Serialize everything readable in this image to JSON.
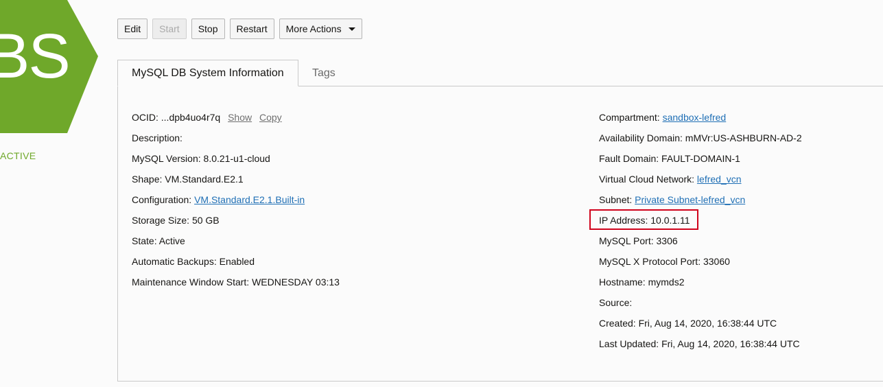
{
  "badge": {
    "text": "BS",
    "color": "#6fa82a",
    "status": "ACTIVE"
  },
  "toolbar": {
    "edit": "Edit",
    "start": "Start",
    "stop": "Stop",
    "restart": "Restart",
    "more_actions": "More Actions"
  },
  "tabs": {
    "info": "MySQL DB System Information",
    "tags": "Tags"
  },
  "left": {
    "ocid_label": "OCID:",
    "ocid_value": "...dpb4uo4r7q",
    "ocid_show": "Show",
    "ocid_copy": "Copy",
    "description_label": "Description:",
    "mysql_version_label": "MySQL Version:",
    "mysql_version_value": "8.0.21-u1-cloud",
    "shape_label": "Shape:",
    "shape_value": "VM.Standard.E2.1",
    "configuration_label": "Configuration:",
    "configuration_value": "VM.Standard.E2.1.Built-in",
    "storage_label": "Storage Size:",
    "storage_value": "50 GB",
    "state_label": "State:",
    "state_value": "Active",
    "backups_label": "Automatic Backups:",
    "backups_value": "Enabled",
    "maintenance_label": "Maintenance Window Start:",
    "maintenance_value": "WEDNESDAY 03:13"
  },
  "right": {
    "compartment_label": "Compartment:",
    "compartment_value": "sandbox-lefred",
    "ad_label": "Availability Domain:",
    "ad_value": "mMVr:US-ASHBURN-AD-2",
    "fault_label": "Fault Domain:",
    "fault_value": "FAULT-DOMAIN-1",
    "vcn_label": "Virtual Cloud Network:",
    "vcn_value": "lefred_vcn",
    "subnet_label": "Subnet:",
    "subnet_value": "Private Subnet-lefred_vcn",
    "ip_label": "IP Address:",
    "ip_value": "10.0.1.11",
    "port_label": "MySQL Port:",
    "port_value": "3306",
    "xport_label": "MySQL X Protocol Port:",
    "xport_value": "33060",
    "hostname_label": "Hostname:",
    "hostname_value": "mymds2",
    "source_label": "Source:",
    "created_label": "Created:",
    "created_value": "Fri, Aug 14, 2020, 16:38:44 UTC",
    "updated_label": "Last Updated:",
    "updated_value": "Fri, Aug 14, 2020, 16:38:44 UTC"
  }
}
